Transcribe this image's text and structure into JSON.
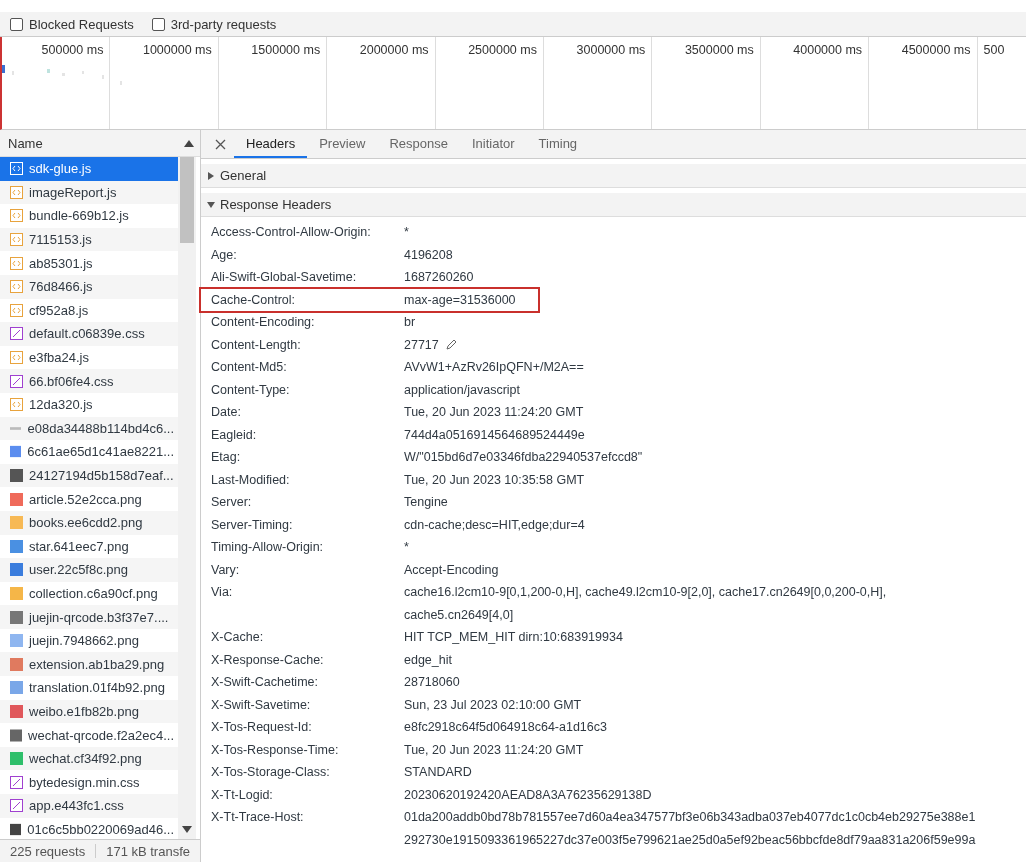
{
  "checkbox_bar": [
    {
      "label": "Blocked Requests",
      "checked": false
    },
    {
      "label": "3rd-party requests",
      "checked": false
    }
  ],
  "timeline": {
    "ticks": [
      "500000 ms",
      "1000000 ms",
      "1500000 ms",
      "2000000 ms",
      "2500000 ms",
      "3000000 ms",
      "3500000 ms",
      "4000000 ms",
      "4500000 ms",
      "500"
    ]
  },
  "request_list": {
    "column": "Name",
    "rows": [
      {
        "name": "sdk-glue.js",
        "kind": "script",
        "selected": true
      },
      {
        "name": "imageReport.js",
        "kind": "script",
        "selected": false
      },
      {
        "name": "bundle-669b12.js",
        "kind": "script",
        "selected": false
      },
      {
        "name": "7115153.js",
        "kind": "script",
        "selected": false
      },
      {
        "name": "ab85301.js",
        "kind": "script",
        "selected": false
      },
      {
        "name": "76d8466.js",
        "kind": "script",
        "selected": false
      },
      {
        "name": "cf952a8.js",
        "kind": "script",
        "selected": false
      },
      {
        "name": "default.c06839e.css",
        "kind": "stylesheet",
        "selected": false
      },
      {
        "name": "e3fba24.js",
        "kind": "script",
        "selected": false
      },
      {
        "name": "66.bf06fe4.css",
        "kind": "stylesheet",
        "selected": false
      },
      {
        "name": "12da320.js",
        "kind": "script",
        "selected": false
      },
      {
        "name": "e08da34488b114bd4c6...",
        "kind": "other",
        "selected": false
      },
      {
        "name": "6c61ae65d1c41ae8221...",
        "kind": "image",
        "color": "#5b8def",
        "selected": false
      },
      {
        "name": "24127194d5b158d7eaf...",
        "kind": "image",
        "color": "#555555",
        "selected": false
      },
      {
        "name": "article.52e2cca.png",
        "kind": "image",
        "color": "#ef6a5a",
        "selected": false
      },
      {
        "name": "books.ee6cdd2.png",
        "kind": "image",
        "color": "#f7b955",
        "selected": false
      },
      {
        "name": "star.641eec7.png",
        "kind": "image",
        "color": "#4a90e2",
        "selected": false
      },
      {
        "name": "user.22c5f8c.png",
        "kind": "image",
        "color": "#3b7ddd",
        "selected": false
      },
      {
        "name": "collection.c6a90cf.png",
        "kind": "image",
        "color": "#f5b648",
        "selected": false
      },
      {
        "name": "juejin-qrcode.b3f37e7....",
        "kind": "image",
        "color": "#777777",
        "selected": false
      },
      {
        "name": "juejin.7948662.png",
        "kind": "image",
        "color": "#8fb6f0",
        "selected": false
      },
      {
        "name": "extension.ab1ba29.png",
        "kind": "image",
        "color": "#e07a5f",
        "selected": false
      },
      {
        "name": "translation.01f4b92.png",
        "kind": "image",
        "color": "#7aa7e8",
        "selected": false
      },
      {
        "name": "weibo.e1fb82b.png",
        "kind": "image",
        "color": "#e0575b",
        "selected": false
      },
      {
        "name": "wechat-qrcode.f2a2ec4...",
        "kind": "image",
        "color": "#666666",
        "selected": false
      },
      {
        "name": "wechat.cf34f92.png",
        "kind": "image",
        "color": "#2fbf6b",
        "selected": false
      },
      {
        "name": "bytedesign.min.css",
        "kind": "stylesheet",
        "selected": false
      },
      {
        "name": "app.e443fc1.css",
        "kind": "stylesheet",
        "selected": false
      },
      {
        "name": "01c6c5bb0220069ad46...",
        "kind": "image",
        "color": "#444444",
        "selected": false
      }
    ]
  },
  "status_bar": [
    "225 requests",
    "171 kB transfe"
  ],
  "detail_tabs": [
    {
      "label": "Headers",
      "selected": true
    },
    {
      "label": "Preview",
      "selected": false
    },
    {
      "label": "Response",
      "selected": false
    },
    {
      "label": "Initiator",
      "selected": false
    },
    {
      "label": "Timing",
      "selected": false
    }
  ],
  "sections": [
    {
      "title": "General",
      "expanded": false
    },
    {
      "title": "Response Headers",
      "expanded": true
    }
  ],
  "response_headers": [
    {
      "key": "Access-Control-Allow-Origin:",
      "value": [
        "*"
      ]
    },
    {
      "key": "Age:",
      "value": [
        "4196208"
      ]
    },
    {
      "key": "Ali-Swift-Global-Savetime:",
      "value": [
        "1687260260"
      ]
    },
    {
      "key": "Cache-Control:",
      "value": [
        "max-age=31536000"
      ],
      "highlighted": true
    },
    {
      "key": "Content-Encoding:",
      "value": [
        "br"
      ]
    },
    {
      "key": "Content-Length:",
      "value": [
        "27717"
      ],
      "editable": true
    },
    {
      "key": "Content-Md5:",
      "value": [
        "AVvW1+AzRv26IpQFN+/M2A=="
      ]
    },
    {
      "key": "Content-Type:",
      "value": [
        "application/javascript"
      ]
    },
    {
      "key": "Date:",
      "value": [
        "Tue, 20 Jun 2023 11:24:20 GMT"
      ]
    },
    {
      "key": "Eagleid:",
      "value": [
        "744d4a0516914564689524449e"
      ]
    },
    {
      "key": "Etag:",
      "value": [
        "W/\"015bd6d7e03346fdba22940537efccd8\""
      ]
    },
    {
      "key": "Last-Modified:",
      "value": [
        "Tue, 20 Jun 2023 10:35:58 GMT"
      ]
    },
    {
      "key": "Server:",
      "value": [
        "Tengine"
      ]
    },
    {
      "key": "Server-Timing:",
      "value": [
        "cdn-cache;desc=HIT,edge;dur=4"
      ]
    },
    {
      "key": "Timing-Allow-Origin:",
      "value": [
        "*"
      ]
    },
    {
      "key": "Vary:",
      "value": [
        "Accept-Encoding"
      ]
    },
    {
      "key": "Via:",
      "value": [
        "cache16.l2cm10-9[0,1,200-0,H], cache49.l2cm10-9[2,0], cache17.cn2649[0,0,200-0,H],",
        "cache5.cn2649[4,0]"
      ]
    },
    {
      "key": "X-Cache:",
      "value": [
        "HIT TCP_MEM_HIT dirn:10:683919934"
      ]
    },
    {
      "key": "X-Response-Cache:",
      "value": [
        "edge_hit"
      ]
    },
    {
      "key": "X-Swift-Cachetime:",
      "value": [
        "28718060"
      ]
    },
    {
      "key": "X-Swift-Savetime:",
      "value": [
        "Sun, 23 Jul 2023 02:10:00 GMT"
      ]
    },
    {
      "key": "X-Tos-Request-Id:",
      "value": [
        "e8fc2918c64f5d064918c64-a1d16c3"
      ]
    },
    {
      "key": "X-Tos-Response-Time:",
      "value": [
        "Tue, 20 Jun 2023 11:24:20 GMT"
      ]
    },
    {
      "key": "X-Tos-Storage-Class:",
      "value": [
        "STANDARD"
      ]
    },
    {
      "key": "X-Tt-Logid:",
      "value": [
        "20230620192420AEAD8A3A76235629138D"
      ]
    },
    {
      "key": "X-Tt-Trace-Host:",
      "value": [
        "01da200addb0bd78b781557ee7d60a4ea347577bf3e06b343adba037eb4077dc1c0cb4eb29275e388e1",
        "292730e1915093361965227dc37e003f5e799621ae25d0a5ef92beac56bbcfde8df79aa831a206f59e99a"
      ]
    }
  ]
}
